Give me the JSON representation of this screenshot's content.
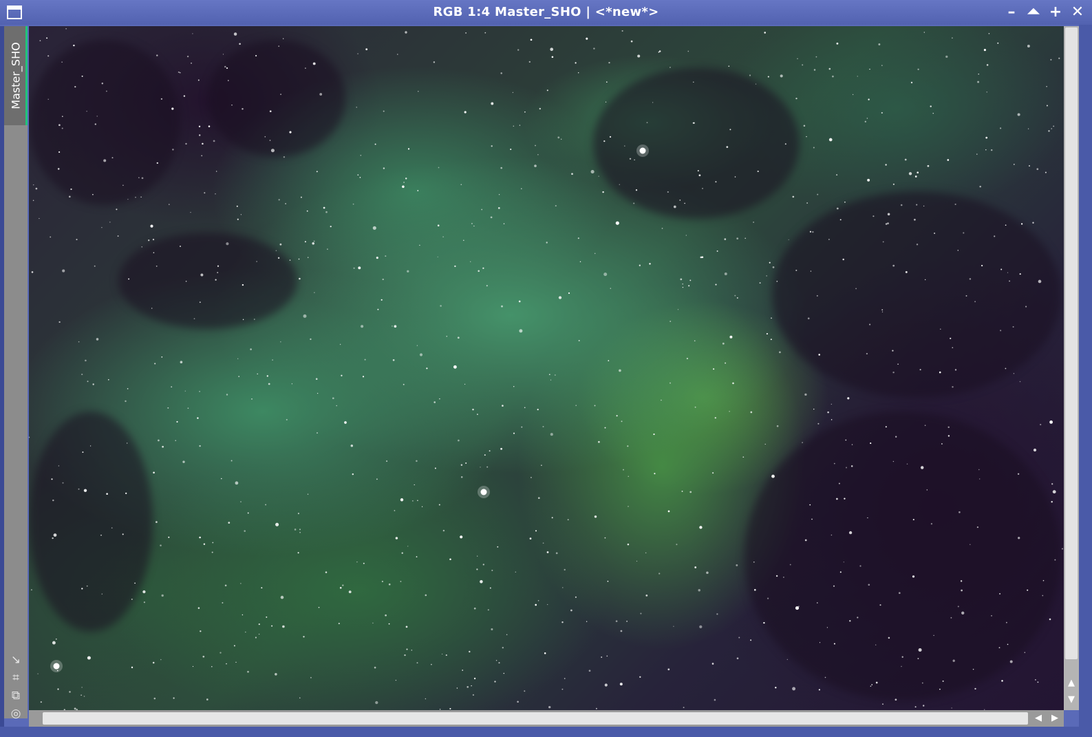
{
  "window": {
    "title": "RGB 1:4 Master_SHO | <*new*>",
    "buttons": {
      "minimize": "–",
      "shade": "⏶",
      "maximize": "+",
      "close": "✕"
    }
  },
  "sidebar": {
    "view_tab_label": "Master_SHO",
    "tools": [
      {
        "icon": "arrow-diagonal-icon",
        "glyph": "↘"
      },
      {
        "icon": "crop-frame-icon",
        "glyph": "⌗"
      },
      {
        "icon": "clone-icon",
        "glyph": "⧉"
      },
      {
        "icon": "target-icon",
        "glyph": "◎"
      }
    ]
  },
  "scrollbars": {
    "vertical": {
      "up": "▲",
      "down": "▼"
    },
    "horizontal": {
      "left": "◀",
      "right": "▶"
    }
  },
  "colors": {
    "title_bar": "#5a6ab8",
    "view_tab_accent": "#21c47a"
  }
}
